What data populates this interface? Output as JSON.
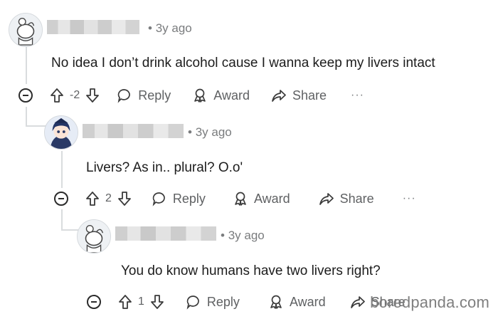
{
  "comments": [
    {
      "time": "3y ago",
      "text": "No idea I don’t drink alcohol cause I wanna keep my livers intact",
      "score": "-2",
      "reply_label": "Reply",
      "award_label": "Award",
      "share_label": "Share",
      "more_label": "···"
    },
    {
      "time": "3y ago",
      "text": "Livers? As in.. plural? O.o'",
      "score": "2",
      "reply_label": "Reply",
      "award_label": "Award",
      "share_label": "Share",
      "more_label": "···"
    },
    {
      "time": "3y ago",
      "text": "You do know humans have two livers right?",
      "score": "1",
      "reply_label": "Reply",
      "award_label": "Award",
      "share_label": "Share"
    }
  ],
  "watermark": "boredpanda.com",
  "icons": {
    "upvote": "arrow-up-icon",
    "downvote": "arrow-down-icon",
    "reply": "speech-bubble-icon",
    "award": "award-icon",
    "share": "share-arrow-icon",
    "collapse": "minus-circle-icon"
  }
}
